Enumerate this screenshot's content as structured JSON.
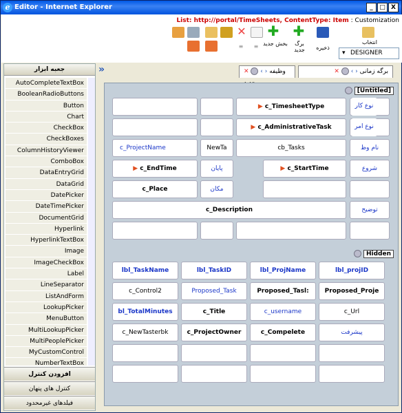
{
  "window": {
    "title": "Editor - Internet Explorer",
    "min": "_",
    "max": "□",
    "close": "X"
  },
  "header": {
    "list_info": "List: http://portal/TimeSheets, ContentType: Item",
    "customization": ": Customization"
  },
  "toolbar": {
    "select_label": "انتخاب",
    "save_label": "ذخیره",
    "new_row_label": "برگ جدید",
    "new_section_label": "بخش جدید",
    "mode_value": "DESIGNER"
  },
  "sidebar": {
    "title": "جعبه ابزار",
    "items": [
      "AutoCompleteTextBox",
      "BooleanRadioButtons",
      "Button",
      "Chart",
      "CheckBox",
      "CheckBoxes",
      "ColumnHistoryViewer",
      "ComboBox",
      "DataEntryGrid",
      "DataGrid",
      "DatePicker",
      "DateTimePicker",
      "DocumentGrid",
      "Hyperlink",
      "HyperlinkTextBox",
      "Image",
      "ImageCheckBox",
      "Label",
      "LineSeparator",
      "ListAndForm",
      "LookupPicker",
      "MenuButton",
      "MultiLookupPicker",
      "MultiPeoplePicker",
      "MyCustomControl",
      "NumberTextBox"
    ],
    "add_control": "افزودن کنترل",
    "hidden_controls": "کنترل های پنهان",
    "unlimited_fields": "فیلدهای غیرمحدود"
  },
  "tabs": {
    "tab1": "برگه زمانی",
    "tab2": "وظیفه جدید",
    "expand": "»"
  },
  "form": {
    "untitled": "[Untitled]",
    "hidden": "Hidden",
    "r1": {
      "label": "نوع کار",
      "field": "c_TimesheetType"
    },
    "r2": {
      "label": "نوع امر",
      "field": "c_AdministrativeTask"
    },
    "r3": {
      "label": "نام وظ",
      "field": "cb_Tasks",
      "mid": "NewTa",
      "left": "c_ProjectName"
    },
    "r4": {
      "label": "شروع",
      "field": "c_StartTime",
      "mid": "پایان",
      "left": "c_EndTime"
    },
    "r5": {
      "mid": "مکان",
      "left": "c_Place"
    },
    "r6": {
      "label": "توضیح",
      "field": "c_Description"
    },
    "h1": [
      "lbl_projID",
      "lbl_ProjName",
      "lbl_TaskID",
      "lbl_TaskName"
    ],
    "h2": [
      "Proposed_Proje",
      "Proposed_Tasl:",
      "Proposed_Task",
      "c_Control2"
    ],
    "h3": [
      "c_Url",
      "c_username",
      "c_Title",
      "bl_TotalMinutes"
    ],
    "h4": [
      "پیشرفت",
      "c_Compelete",
      "c_ProjectOwner",
      "c_NewTasterbk"
    ]
  },
  "colors": {
    "titlebar": "#0058e6",
    "canvas": "#c4cfd9",
    "label_blue": "#1a36c8",
    "list_red": "#cc0000"
  }
}
